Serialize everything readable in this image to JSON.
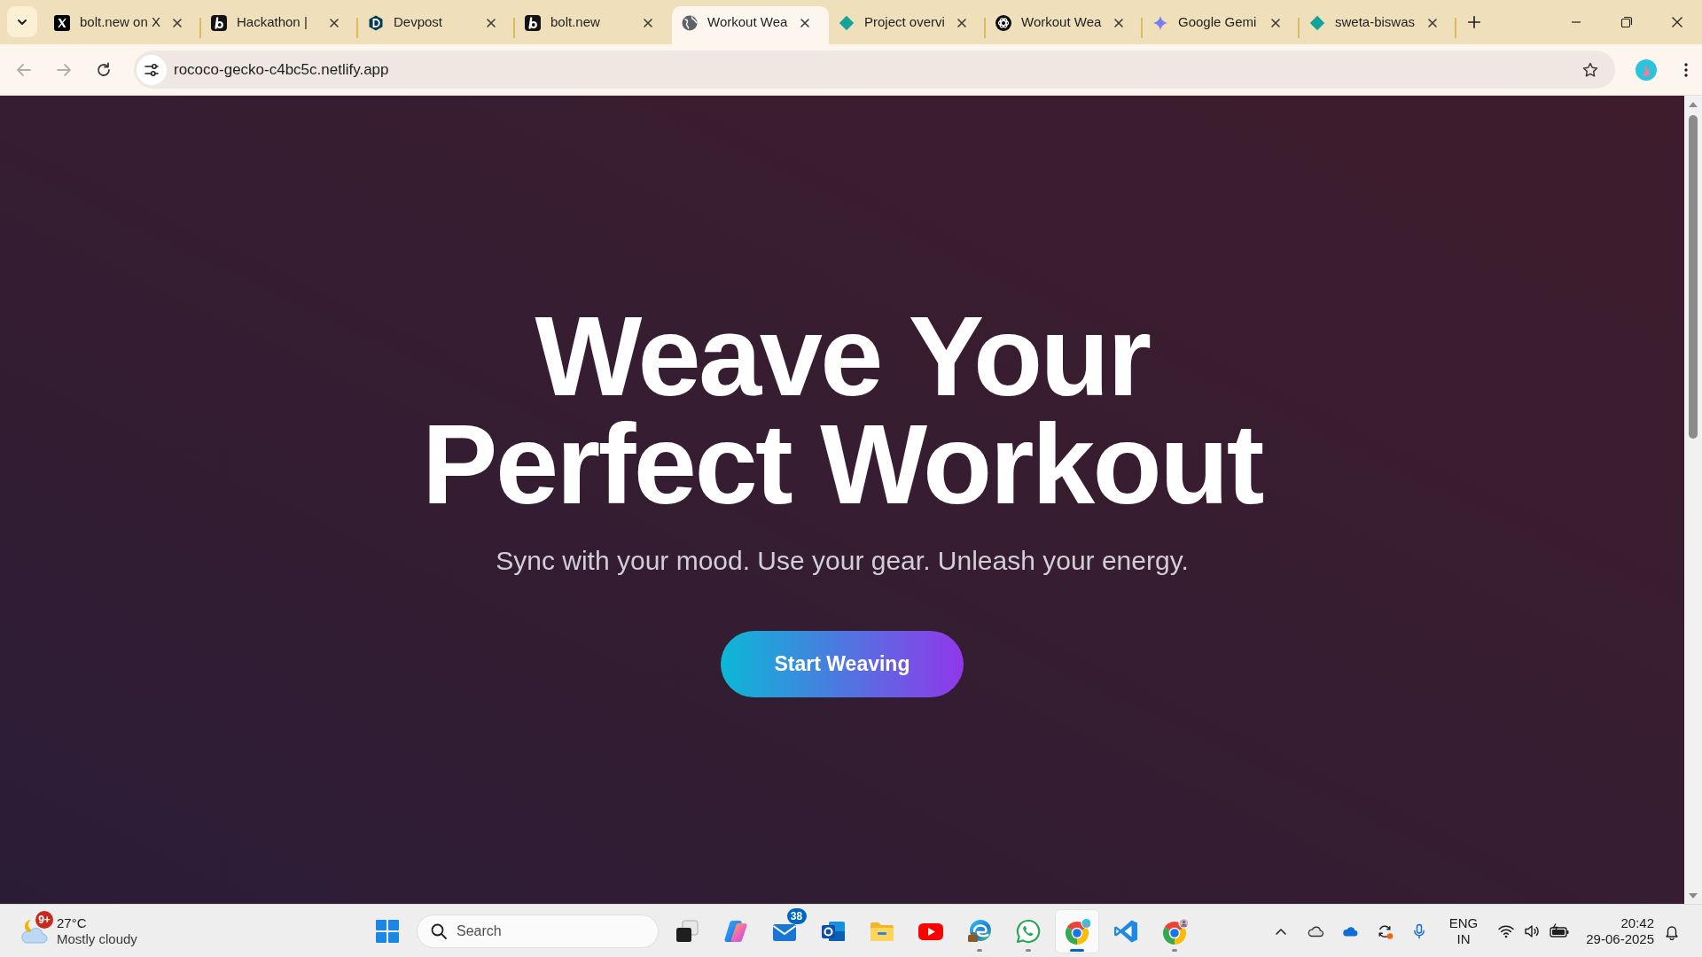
{
  "tabs": [
    {
      "kind": "x-logo",
      "title": "bolt.new on X",
      "selected": false
    },
    {
      "kind": "b-logo",
      "title": "Hackathon |",
      "selected": false
    },
    {
      "kind": "hexagon-logo",
      "title": "Devpost",
      "selected": false
    },
    {
      "kind": "b-logo",
      "title": "bolt.new",
      "selected": false
    },
    {
      "kind": "globe",
      "title": "Workout Wea",
      "selected": true
    },
    {
      "kind": "diamond",
      "title": "Project overvi",
      "selected": false
    },
    {
      "kind": "knot-logo",
      "title": "Workout Wea",
      "selected": false
    },
    {
      "kind": "sparkle",
      "title": "Google Gemi",
      "selected": false
    },
    {
      "kind": "diamond",
      "title": "sweta-biswas",
      "selected": false
    }
  ],
  "address_bar": {
    "back": {
      "disabled": true
    },
    "forward": {
      "disabled": true
    },
    "url": "rococo-gecko-c4bc5c.netlify.app"
  },
  "page": {
    "heading_lines": [
      "Weave Your",
      "Perfect Workout"
    ],
    "subtitle": "Sync with your mood. Use your gear. Unleash your energy.",
    "button": "Start Weaving"
  },
  "taskbar": {
    "weather": {
      "badge": "9+",
      "temperature": "27°C",
      "condition": "Mostly cloudy"
    },
    "search": {
      "placeholder": "Search"
    },
    "apps": [
      {
        "kind": "task-view",
        "selected": false,
        "running": false
      },
      {
        "kind": "swirl",
        "selected": false,
        "running": false
      },
      {
        "kind": "mail",
        "badge": "38",
        "selected": false,
        "running": false
      },
      {
        "kind": "outlook",
        "selected": false,
        "running": false
      },
      {
        "kind": "folder",
        "selected": false,
        "running": false
      },
      {
        "kind": "video",
        "selected": false,
        "running": false
      },
      {
        "kind": "edge",
        "selected": false,
        "running": true
      },
      {
        "kind": "whatsapp",
        "selected": false,
        "running": true
      },
      {
        "kind": "chrome",
        "selected": true,
        "running": true
      },
      {
        "kind": "code-editor",
        "selected": false,
        "running": false
      },
      {
        "kind": "chrome-second-profile",
        "selected": false,
        "running": true
      }
    ],
    "tray": {
      "language": "ENG",
      "region": "IN"
    },
    "clock": {
      "time": "20:42",
      "date": "29-06-2025"
    }
  }
}
